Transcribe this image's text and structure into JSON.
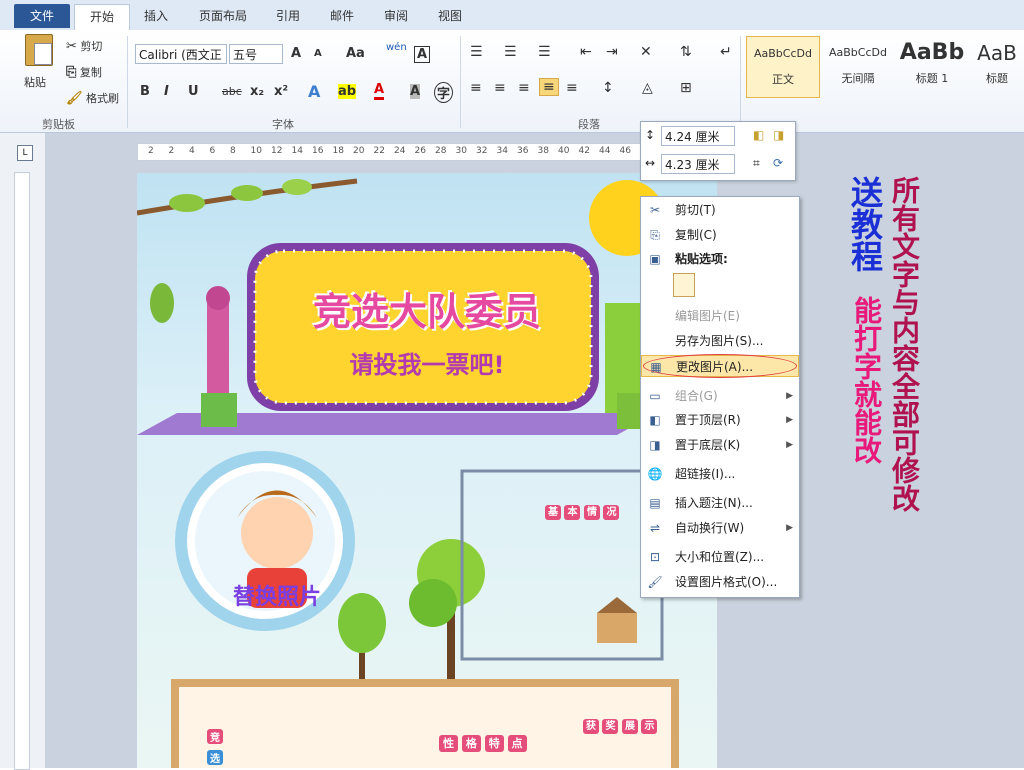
{
  "tabs": [
    "文件",
    "开始",
    "插入",
    "页面布局",
    "引用",
    "邮件",
    "审阅",
    "视图"
  ],
  "clipboard": {
    "paste": "粘贴",
    "cut": "剪切",
    "copy": "复制",
    "format_painter": "格式刷",
    "group": "剪贴板"
  },
  "font": {
    "family": "Calibri (西文正",
    "size": "五号",
    "group": "字体",
    "buttons": {
      "grow": "A",
      "shrink": "A",
      "aa": "Aa",
      "pinyin": "wén",
      "border": "A",
      "bold": "B",
      "italic": "I",
      "underline": "U",
      "strike": "abc",
      "sub": "x₂",
      "sup": "x²",
      "effects": "A",
      "highlight": "ab",
      "color": "A",
      "shade": "A",
      "enclose": "字"
    }
  },
  "paragraph": {
    "group": "段落"
  },
  "styles": [
    {
      "sample": "AaBbCcDd",
      "label": "正文"
    },
    {
      "sample": "AaBbCcDd",
      "label": "无间隔"
    },
    {
      "sample": "AaBb",
      "label": "标题 1"
    },
    {
      "sample": "AaB",
      "label": "标题"
    }
  ],
  "ruler_ticks": [
    "2",
    "2",
    "4",
    "6",
    "8",
    "10",
    "12",
    "14",
    "16",
    "18",
    "20",
    "22",
    "24",
    "26",
    "28",
    "30",
    "32",
    "34",
    "36",
    "38",
    "40",
    "42",
    "44",
    "46"
  ],
  "floatbar": {
    "height": "4.24 厘米",
    "width": "4.23 厘米"
  },
  "context_menu": [
    {
      "label": "剪切(T)",
      "icon": "scissors-icon",
      "glyph": "✂",
      "enabled": true
    },
    {
      "label": "复制(C)",
      "icon": "copy-icon",
      "glyph": "⎘",
      "enabled": true
    },
    {
      "label": "粘贴选项:",
      "icon": "paste-icon",
      "glyph": "📋",
      "enabled": true,
      "bold": true
    },
    {
      "label": "编辑图片(E)",
      "icon": "edit-picture-icon",
      "glyph": "",
      "enabled": false
    },
    {
      "label": "另存为图片(S)...",
      "icon": "",
      "glyph": "",
      "enabled": true
    },
    {
      "label": "更改图片(A)...",
      "icon": "change-picture-icon",
      "glyph": "▦",
      "enabled": true,
      "highlight": true
    },
    {
      "label": "组合(G)",
      "icon": "group-icon",
      "glyph": "▭",
      "enabled": false,
      "submenu": true
    },
    {
      "label": "置于顶层(R)",
      "icon": "bring-front-icon",
      "glyph": "◧",
      "enabled": true,
      "submenu": true
    },
    {
      "label": "置于底层(K)",
      "icon": "send-back-icon",
      "glyph": "◨",
      "enabled": true,
      "submenu": true
    },
    {
      "label": "超链接(I)...",
      "icon": "hyperlink-icon",
      "glyph": "🌐",
      "enabled": true
    },
    {
      "label": "插入题注(N)...",
      "icon": "caption-icon",
      "glyph": "▤",
      "enabled": true
    },
    {
      "label": "自动换行(W)",
      "icon": "wrap-icon",
      "glyph": "⇌",
      "enabled": true,
      "submenu": true
    },
    {
      "label": "大小和位置(Z)...",
      "icon": "size-icon",
      "glyph": "⊡",
      "enabled": true
    },
    {
      "label": "设置图片格式(O)...",
      "icon": "format-picture-icon",
      "glyph": "🖌",
      "enabled": true
    }
  ],
  "poster": {
    "title": "竞选大队委员",
    "subtitle": "请投我一票吧!",
    "replace_photo": "替换照片",
    "tags1": [
      "基",
      "本",
      "情",
      "况"
    ],
    "tags2": [
      "性",
      "格",
      "特",
      "点"
    ],
    "tags3": [
      "获",
      "奖",
      "展",
      "示"
    ],
    "tags4": [
      "竞",
      "选"
    ]
  },
  "promo": {
    "line1": "送教程",
    "line2": "能打字就能改",
    "line3": "所有文字与内容全部可修改"
  },
  "colors": {
    "accent": "#2b5797",
    "promo_blue": "#1a2fd6",
    "promo_red": "#e8197a",
    "promo_dark": "#b0124f"
  }
}
